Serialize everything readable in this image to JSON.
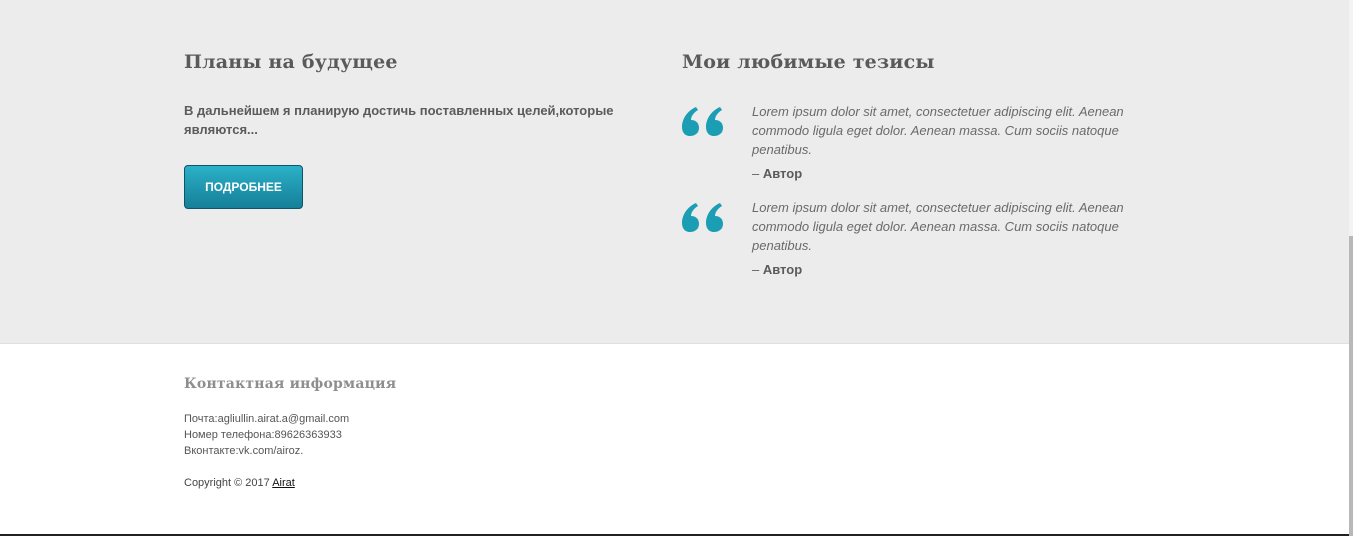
{
  "plans": {
    "heading": "Планы на будущее",
    "text": "В дальнейшем я планирую достичь поставленных целей,которые являются...",
    "button_label": "ПОДРОБНЕЕ"
  },
  "theses": {
    "heading": "Мои любимые тезисы",
    "quote_color": "#1b9db4",
    "items": [
      {
        "text": "Lorem ipsum dolor sit amet, consectetuer adipiscing elit. Aenean commodo ligula eget dolor. Aenean massa. Cum sociis natoque penatibus.",
        "author_prefix": "– ",
        "author": "Автор"
      },
      {
        "text": "Lorem ipsum dolor sit amet, consectetuer adipiscing elit. Aenean commodo ligula eget dolor. Aenean massa. Cum sociis natoque penatibus.",
        "author_prefix": "– ",
        "author": "Автор"
      }
    ]
  },
  "contact": {
    "heading": "Контактная информация",
    "email_line": "Почта:agliullin.airat.a@gmail.com",
    "phone_line": "Номер телефона:89626363933",
    "vk_line": "Вконтакте:vk.com/airoz.",
    "copyright_prefix": "Copyright © 2017 ",
    "copyright_link": "Airat"
  }
}
